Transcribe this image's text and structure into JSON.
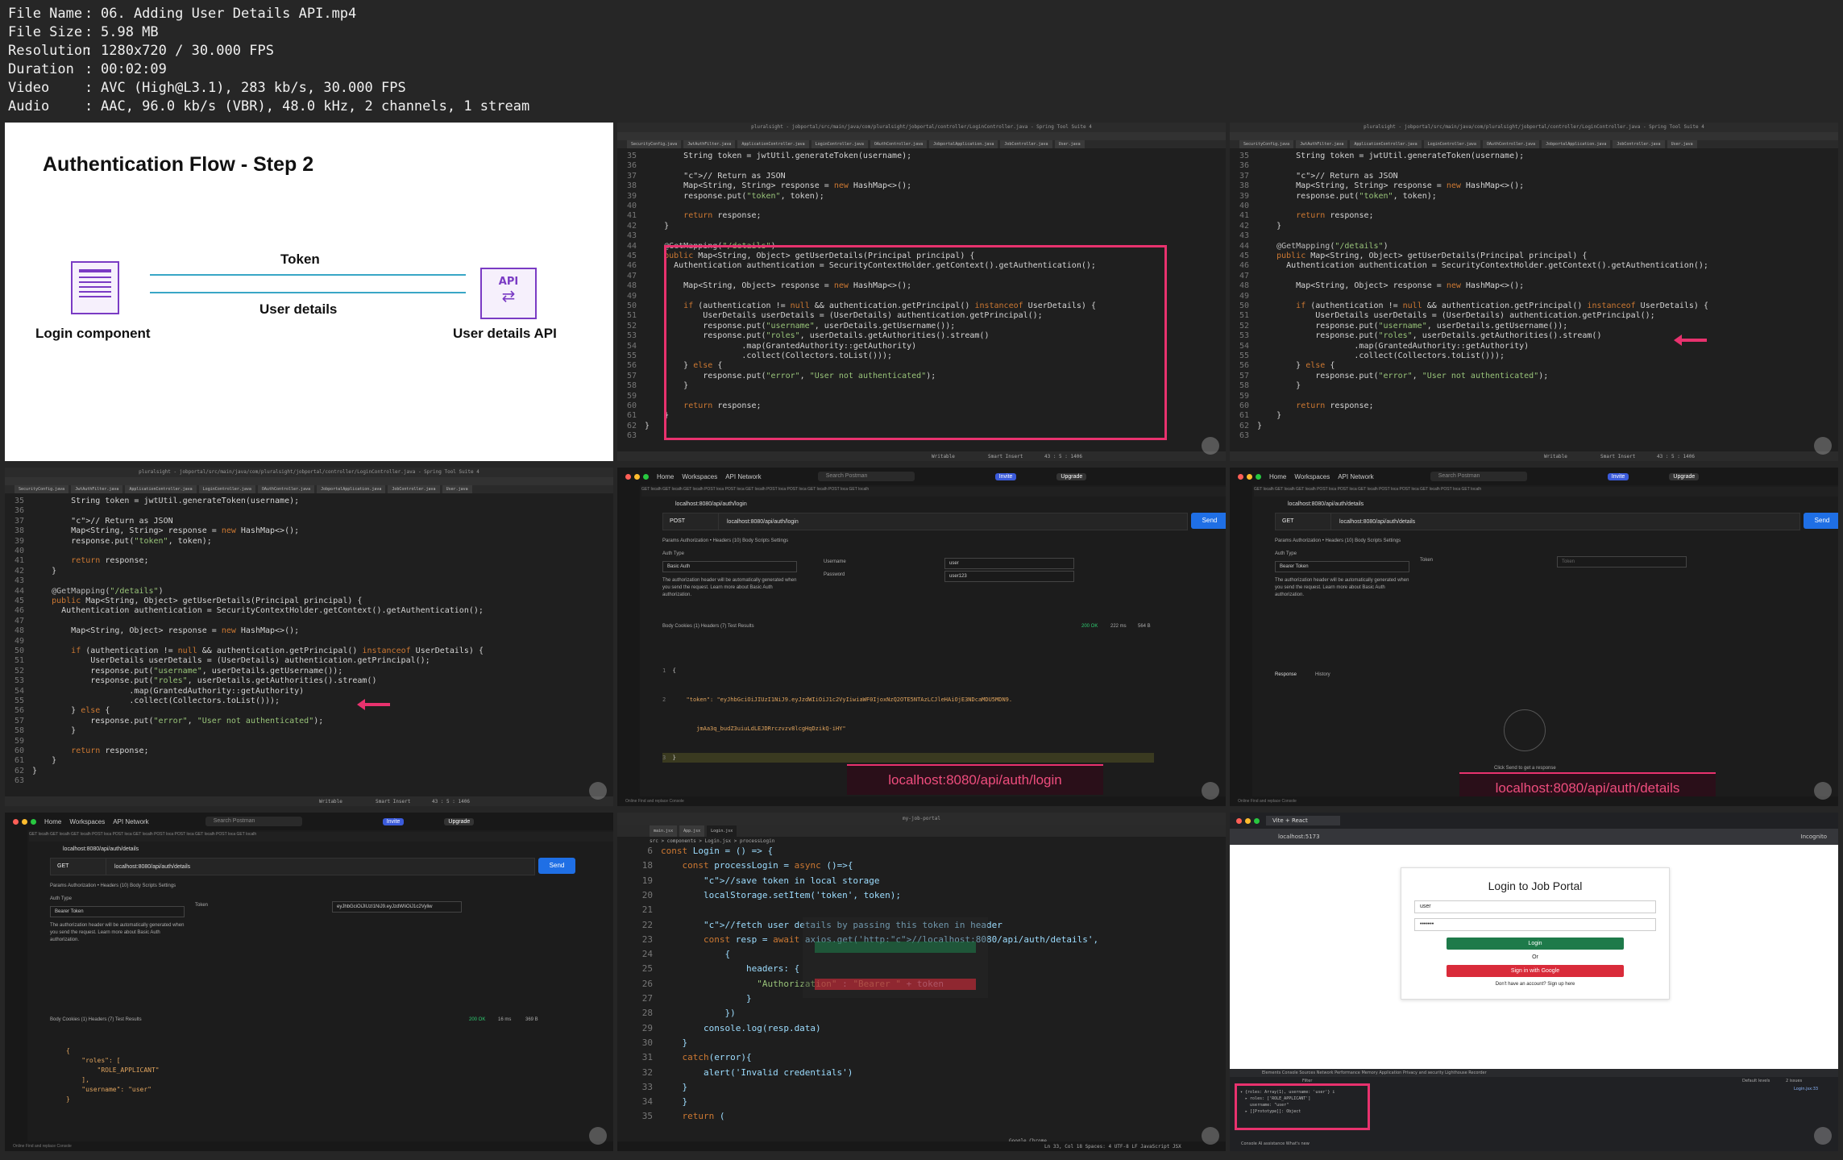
{
  "meta": [
    {
      "key": "File Name",
      "value": "06. Adding User Details API.mp4"
    },
    {
      "key": "File Size",
      "value": "5.98 MB"
    },
    {
      "key": "Resolution",
      "value": "1280x720 / 30.000 FPS"
    },
    {
      "key": "Duration",
      "value": "00:02:09"
    },
    {
      "key": "Video",
      "value": "AVC (High@L3.1), 283 kb/s, 30.000 FPS"
    },
    {
      "key": "Audio",
      "value": "AAC, 96.0 kb/s (VBR), 48.0 kHz, 2 channels, 1 stream"
    }
  ],
  "slide": {
    "title": "Authentication Flow - Step 2",
    "token_label": "Token",
    "details_label": "User details",
    "left_caption": "Login component",
    "right_caption": "User details API",
    "api_text": "API"
  },
  "ide": {
    "window_title": "pluralsight - jobportal/src/main/java/com/pluralsight/jobportal/controller/LoginController.java - Spring Tool Suite 4",
    "tabs": [
      "SecurityConfig.java",
      "JwtAuthFilter.java",
      "ApplicationController.java",
      "LoginController.java",
      "OAuthController.java",
      "JobportalApplication.java",
      "JobController.java",
      "User.java"
    ],
    "status_writable": "Writable",
    "status_insert": "Smart Insert",
    "status_pos": "43 : 5 : 1406"
  },
  "code_lines": [
    {
      "n": "35",
      "text": "        String token = jwtUtil.generateToken(username);"
    },
    {
      "n": "36",
      "text": ""
    },
    {
      "n": "37",
      "text": "        // Return as JSON"
    },
    {
      "n": "38",
      "text": "        Map<String, String> response = new HashMap<>();"
    },
    {
      "n": "39",
      "text": "        response.put(\"token\", token);"
    },
    {
      "n": "40",
      "text": ""
    },
    {
      "n": "41",
      "text": "        return response;"
    },
    {
      "n": "42",
      "text": "    }"
    },
    {
      "n": "43",
      "text": ""
    },
    {
      "n": "44",
      "text": "    @GetMapping(\"/details\")"
    },
    {
      "n": "45",
      "text": "    public Map<String, Object> getUserDetails(Principal principal) {"
    },
    {
      "n": "46",
      "text": "      Authentication authentication = SecurityContextHolder.getContext().getAuthentication();"
    },
    {
      "n": "47",
      "text": ""
    },
    {
      "n": "48",
      "text": "        Map<String, Object> response = new HashMap<>();"
    },
    {
      "n": "49",
      "text": ""
    },
    {
      "n": "50",
      "text": "        if (authentication != null && authentication.getPrincipal() instanceof UserDetails) {"
    },
    {
      "n": "51",
      "text": "            UserDetails userDetails = (UserDetails) authentication.getPrincipal();"
    },
    {
      "n": "52",
      "text": "            response.put(\"username\", userDetails.getUsername());"
    },
    {
      "n": "53",
      "text": "            response.put(\"roles\", userDetails.getAuthorities().stream()"
    },
    {
      "n": "54",
      "text": "                    .map(GrantedAuthority::getAuthority)"
    },
    {
      "n": "55",
      "text": "                    .collect(Collectors.toList()));"
    },
    {
      "n": "56",
      "text": "        } else {"
    },
    {
      "n": "57",
      "text": "            response.put(\"error\", \"User not authenticated\");"
    },
    {
      "n": "58",
      "text": "        }"
    },
    {
      "n": "59",
      "text": ""
    },
    {
      "n": "60",
      "text": "        return response;"
    },
    {
      "n": "61",
      "text": "    }"
    },
    {
      "n": "62",
      "text": "}"
    },
    {
      "n": "63",
      "text": ""
    }
  ],
  "postman": {
    "nav_home": "Home",
    "nav_workspaces": "Workspaces",
    "nav_api": "API Network",
    "search": "Search Postman",
    "invite": "Invite",
    "upgrade": "Upgrade",
    "send": "Send",
    "login": {
      "title": "localhost:8080/api/auth/login",
      "method": "POST",
      "url": "localhost:8080/api/auth/login",
      "auth_type_label": "Auth Type",
      "auth_type": "Basic Auth",
      "username_label": "Username",
      "username": "user",
      "password_label": "Password",
      "password": "user123",
      "status": "200 OK",
      "time": "222 ms",
      "size": "564 B",
      "json_key": "\"token\": \"eyJhbGciOiJIUzI1NiJ9.eyJzdWIiOiJ1c2VyIiwiaWF0IjoxNzQ2OTE5NTAzLCJleHAiOjE3NDcaMDU5MDN9.",
      "json_cont": "jmAa3q_budZ3uiuLdLEJDRrczvzv8lcgHqDzikQ-iHY\""
    },
    "details": {
      "title": "localhost:8080/api/auth/details",
      "method": "GET",
      "url": "localhost:8080/api/auth/details",
      "auth_type": "Bearer Token",
      "token_label": "Token",
      "token_placeholder": "Token",
      "token_value": "eyJhbGciOiJIUzI1NiJ9.eyJzdWIiOiJ1c2Vyliw",
      "response_label": "Response",
      "history_label": "History",
      "empty_hint": "Click Send to get a response",
      "status": "200 OK",
      "time": "16 ms",
      "size": "369 B",
      "json": "{\n    \"roles\": [\n        \"ROLE_APPLICANT\"\n    ],\n    \"username\": \"user\"\n}"
    },
    "tabs_text": "GET localh  GET localh  GET localh  POST loca  POST loca  GET localh  POST loca  POST loca  GET localh  POST loca  GET localh",
    "auth_tabs": "Params    Authorization •    Headers (10)    Body    Scripts    Settings",
    "auth_hint": "The authorization header will be automatically generated when you send the request. Learn more about Basic Auth authorization.",
    "resp_tabs": "Body    Cookies (1)    Headers (7)    Test Results",
    "bottom_status": "Online   Find and replace   Console"
  },
  "captions": {
    "login_url": "localhost:8080/api/auth/login",
    "details_url": "localhost:8080/api/auth/details"
  },
  "vscode": {
    "title": "my-job-portal",
    "tab1": "main.jsx",
    "tab2": "App.jsx",
    "tab3": "Login.jsx",
    "breadcrumb": "src > components > Login.jsx > processLogin",
    "status": "Ln 33, Col 18   Spaces: 4   UTF-8   LF   JavaScript JSX",
    "tooltip": "Google Chrome",
    "lines": [
      {
        "n": "6",
        "text": "const Login = () => {"
      },
      {
        "n": "18",
        "text": "    const processLogin = async ()=>{"
      },
      {
        "n": "19",
        "text": "        //save token in local storage"
      },
      {
        "n": "20",
        "text": "        localStorage.setItem('token', token);"
      },
      {
        "n": "21",
        "text": ""
      },
      {
        "n": "22",
        "text": "        //fetch user details by passing this token in header"
      },
      {
        "n": "23",
        "text": "        const resp = await axios.get('http://localhost:8080/api/auth/details',"
      },
      {
        "n": "24",
        "text": "            {"
      },
      {
        "n": "25",
        "text": "                headers: {"
      },
      {
        "n": "26",
        "text": "                  \"Authorization\" : \"Bearer \" + token"
      },
      {
        "n": "27",
        "text": "                }"
      },
      {
        "n": "28",
        "text": "            })"
      },
      {
        "n": "29",
        "text": "        console.log(resp.data)"
      },
      {
        "n": "30",
        "text": "    }"
      },
      {
        "n": "31",
        "text": "    catch(error){"
      },
      {
        "n": "32",
        "text": "        alert('Invalid credentials')"
      },
      {
        "n": "33",
        "text": "    }"
      },
      {
        "n": "34",
        "text": "    }"
      },
      {
        "n": "35",
        "text": "    return ("
      }
    ]
  },
  "browser": {
    "tab": "Vite + React",
    "address": "localhost:5173",
    "incognito": "Incognito",
    "card_title": "Login to Job Portal",
    "username": "user",
    "password": "•••••••",
    "login_btn": "Login",
    "or_text": "Or",
    "google_btn": "Sign in with Google",
    "signup": "Don't have an account? Sign up here",
    "devtools_tabs": "Elements   Console   Sources   Network   Performance   Memory   Application   Privacy and security   Lighthouse   Recorder",
    "console_text": "▾ {roles: Array(1), username: 'user'} i\n  ▸ roles: ['ROLE_APPLICANT']\n    username: \"user\"\n  ▸ [[Prototype]]: Object",
    "console_source": "Login.jsx:33",
    "issues": "2 issues",
    "filter": "Filter",
    "levels": "Default levels",
    "bottom_tabs": "Console   AI assistance   What's new"
  },
  "colors": {
    "accent_pink": "#e8326e",
    "postman_blue": "#1f6fe5",
    "login_green": "#1e7a4a",
    "google_red": "#d92b3a"
  }
}
